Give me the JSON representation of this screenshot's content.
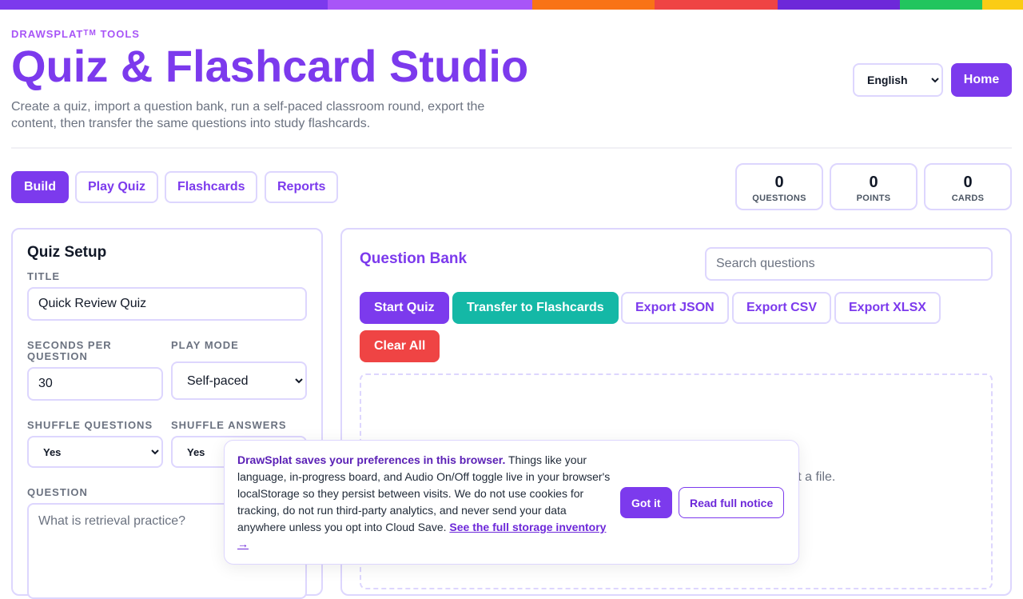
{
  "topbar_colors": [
    "#7c3aed",
    "#a855f7",
    "#f97316",
    "#ef4444",
    "#6d28d9",
    "#22c55e",
    "#facc15"
  ],
  "header": {
    "brand": "DRAWSPLAT",
    "brand_tm": "TM",
    "brand_suffix": " TOOLS",
    "title": "Quiz & Flashcard Studio",
    "subtitle": "Create a quiz, import a question bank, run a self-paced classroom round, export the content, then transfer the same questions into study flashcards.",
    "language": {
      "selected": "English",
      "options": [
        "English"
      ]
    },
    "home_label": "Home"
  },
  "tabs": [
    {
      "label": "Build",
      "active": true
    },
    {
      "label": "Play Quiz",
      "active": false
    },
    {
      "label": "Flashcards",
      "active": false
    },
    {
      "label": "Reports",
      "active": false
    }
  ],
  "stats": [
    {
      "value": "0",
      "label": "QUESTIONS"
    },
    {
      "value": "0",
      "label": "POINTS"
    },
    {
      "value": "0",
      "label": "CARDS"
    }
  ],
  "setup": {
    "heading": "Quiz Setup",
    "title_label": "TITLE",
    "title_value": "Quick Review Quiz",
    "seconds_label": "SECONDS PER QUESTION",
    "seconds_value": "30",
    "play_mode_label": "PLAY MODE",
    "play_mode_value": "Self-paced",
    "shuffle_questions_label": "SHUFFLE QUESTIONS",
    "shuffle_questions_value": "Yes",
    "shuffle_answers_label": "SHUFFLE ANSWERS",
    "shuffle_answers_value": "Yes",
    "question_label": "QUESTION",
    "question_placeholder": "What is retrieval practice?"
  },
  "bank": {
    "heading": "Question Bank",
    "search_placeholder": "Search questions",
    "buttons": {
      "start_quiz": "Start Quiz",
      "transfer": "Transfer to Flashcards",
      "export_json": "Export JSON",
      "export_csv": "Export CSV",
      "export_xlsx": "Export XLSX",
      "clear_all": "Clear All"
    },
    "empty_text_visible": "ort a file."
  },
  "notice": {
    "bold": "DrawSplat saves your preferences in this browser.",
    "body": " Things like your language, in-progress board, and Audio On/Off toggle live in your browser's localStorage so they persist between visits. We do not use cookies for tracking, do not run third-party analytics, and never send your data anywhere unless you opt into Cloud Save. ",
    "link": "See the full storage inventory →",
    "got_it": "Got it",
    "read_full": "Read full notice"
  }
}
